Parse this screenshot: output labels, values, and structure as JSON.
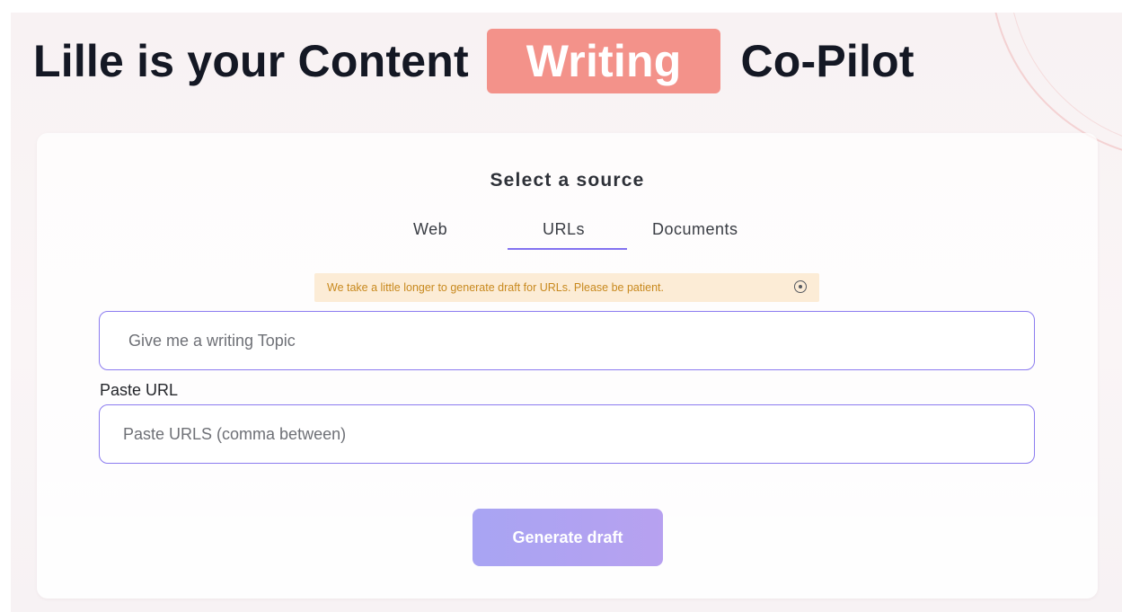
{
  "headline": {
    "before": "Lille is your Content",
    "highlight": "Writing",
    "after": "Co-Pilot"
  },
  "source_panel": {
    "title": "Select a source",
    "tabs": [
      {
        "label": "Web",
        "active": false
      },
      {
        "label": "URLs",
        "active": true
      },
      {
        "label": "Documents",
        "active": false
      }
    ],
    "notice": "We take a little longer to generate draft for URLs. Please be patient.",
    "topic_input": {
      "value": "",
      "placeholder": "Give me a writing Topic"
    },
    "url_label": "Paste URL",
    "url_input": {
      "value": "",
      "placeholder": "Paste URLS (comma between)"
    },
    "generate_button": "Generate draft"
  },
  "colors": {
    "highlight": "#f3928a",
    "accent": "#8372f0",
    "notice_bg": "#fcecd6",
    "notice_text": "#c8891e",
    "button_gradient_start": "#a8a4f3",
    "button_gradient_end": "#b7a1f0"
  }
}
